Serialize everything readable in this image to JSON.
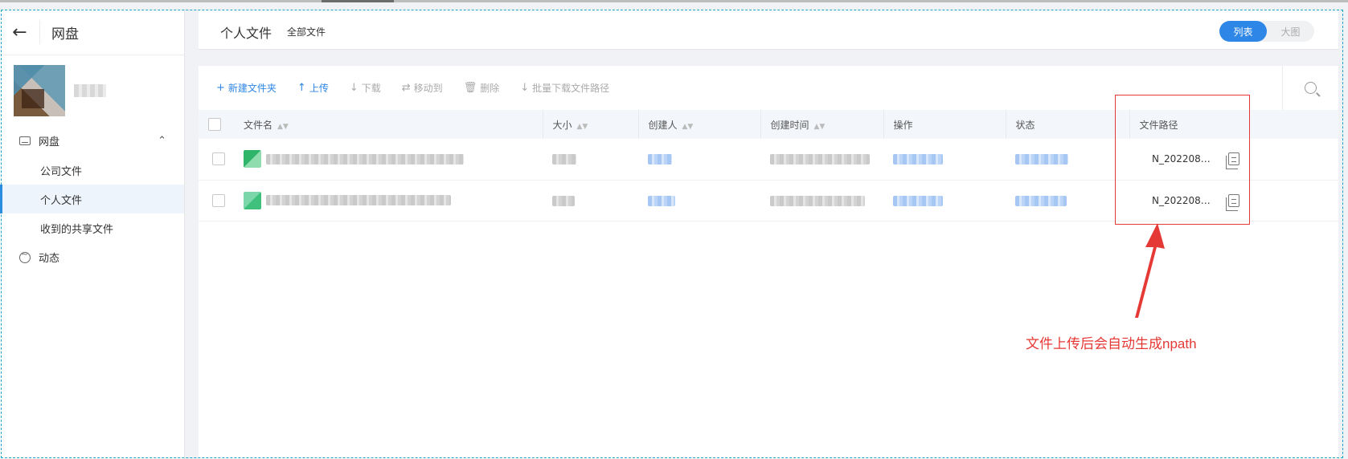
{
  "sidebar": {
    "title": "网盘",
    "nav": {
      "root_label": "网盘",
      "sub_items": [
        "公司文件",
        "个人文件",
        "收到的共享文件"
      ],
      "activity_label": "动态"
    }
  },
  "header": {
    "title": "个人文件",
    "breadcrumb": "全部文件",
    "view_list": "列表",
    "view_grid": "大图"
  },
  "toolbar": {
    "new_folder": "新建文件夹",
    "upload": "上传",
    "download": "下载",
    "move_to": "移动到",
    "delete": "删除",
    "batch_download_path": "批量下载文件路径"
  },
  "table": {
    "columns": [
      "文件名",
      "大小",
      "创建人",
      "创建时间",
      "操作",
      "状态",
      "文件路径"
    ],
    "rows": [
      {
        "npath": "N_202208_..."
      },
      {
        "npath": "N_202208_..."
      }
    ]
  },
  "annotation": {
    "text": "文件上传后会自动生成npath",
    "color": "#e53935"
  },
  "colors": {
    "accent": "#2e86e6"
  }
}
